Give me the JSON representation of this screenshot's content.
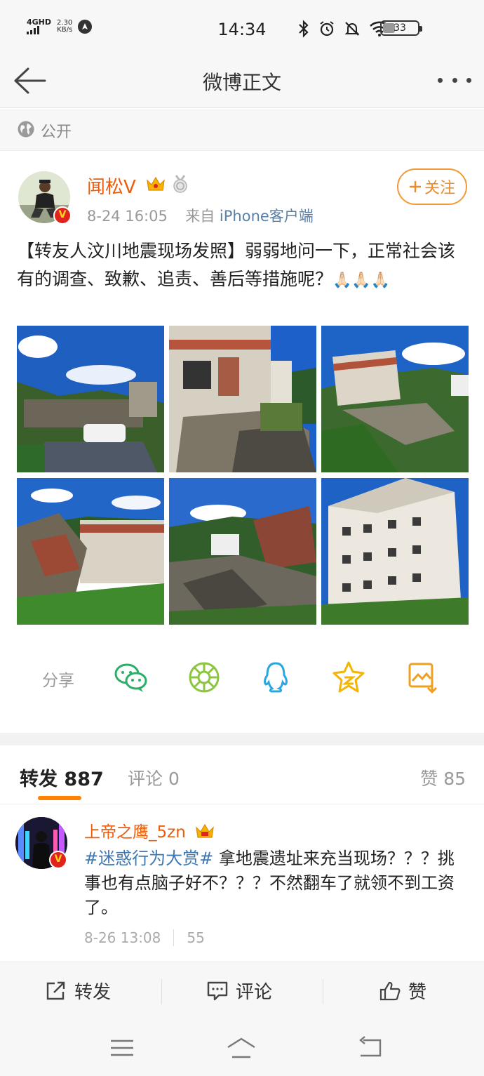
{
  "status_bar": {
    "network": "4GHD",
    "speed_value": "2.30",
    "speed_unit": "KB/s",
    "time": "14:34",
    "battery": "33",
    "icons": [
      "bluetooth-icon",
      "alarm-icon",
      "mute-icon",
      "wifi-icon",
      "battery-icon"
    ]
  },
  "nav": {
    "title": "微博正文",
    "back_icon": "back-arrow-icon",
    "more_icon": "more-icon"
  },
  "visibility": {
    "label": "公开",
    "icon": "globe-icon"
  },
  "post": {
    "username": "闻松V",
    "time": "8-24 16:05",
    "source_prefix": "来自",
    "source": "iPhone客户端",
    "follow_label": "关注",
    "text": "【转友人汶川地震现场发照】弱弱地问一下，正常社会该有的调查、致歉、追责、善后等措施呢？",
    "trailing_emoji": "🙏🏻🙏🏻🙏🏻",
    "photo_count": 6
  },
  "share": {
    "label": "分享",
    "targets": [
      "wechat-icon",
      "moments-icon",
      "qq-icon",
      "qzone-icon",
      "save-image-icon"
    ]
  },
  "tabs": {
    "repost_label": "转发",
    "repost_count": "887",
    "comment_label": "评论",
    "comment_count": "0",
    "like_label": "赞",
    "like_count": "85"
  },
  "repost": {
    "username": "上帝之鹰_5zn",
    "topic": "#迷惑行为大赏#",
    "text": " 拿地震遗址来充当现场？？？挑事也有点脑子好不？？？不然翻车了就领不到工资了。",
    "time": "8-26 13:08",
    "likes": "55"
  },
  "actions": {
    "repost": "转发",
    "comment": "评论",
    "like": "赞"
  },
  "colors": {
    "username": "#ea5d0e",
    "link": "#5b7fa6",
    "accent": "#ff8200",
    "topic": "#3e78b4"
  }
}
